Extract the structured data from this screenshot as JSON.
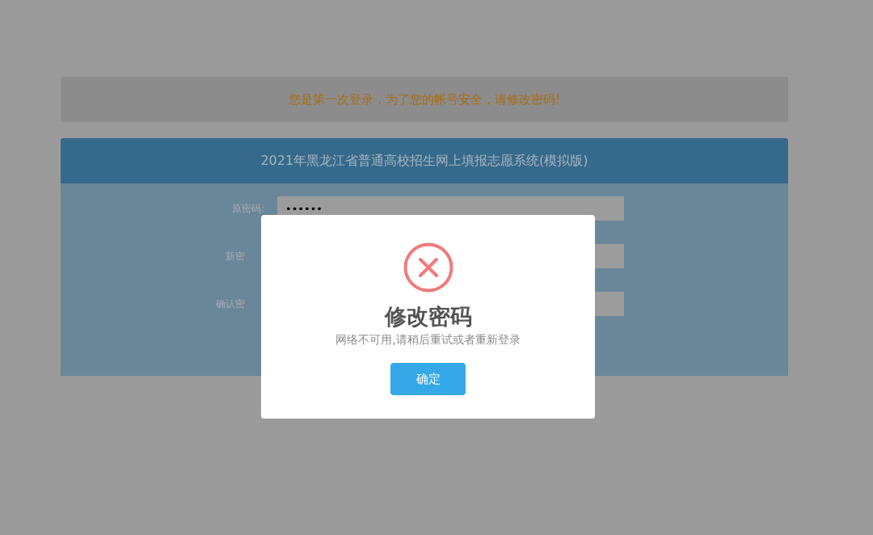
{
  "notice": "您是第一次登录，为了您的帐号安全，请修改密码!",
  "panel": {
    "title": "2021年黑龙江省普通高校招生网上填报志愿系统(模拟版)",
    "fields": [
      {
        "label": "原密码:",
        "value": "••••••",
        "covered": false
      },
      {
        "label": "新密",
        "covered": true
      },
      {
        "label": "确认密",
        "covered": true
      }
    ]
  },
  "dialog": {
    "kind": "error",
    "title": "修改密码",
    "message": "网络不可用,请稍后重试或者重新登录",
    "button": "确定"
  }
}
